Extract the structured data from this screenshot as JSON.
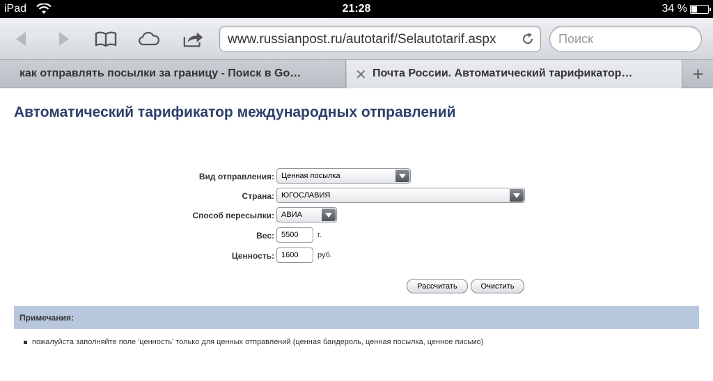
{
  "status_bar": {
    "device": "iPad",
    "time": "21:28",
    "battery": "34 %",
    "battery_level": 0.34
  },
  "toolbar": {
    "url": "www.russianpost.ru/autotarif/Selautotarif.aspx",
    "search_placeholder": "Поиск"
  },
  "tabs": [
    {
      "label": "как отправлять посылки за границу - Поиск в Go…",
      "active": false
    },
    {
      "label": "Почта России. Автоматический тарификатор…",
      "active": true
    }
  ],
  "page": {
    "title": "Автоматический тарификатор международных отправлений",
    "form": {
      "shipment_type": {
        "label": "Вид отправления:",
        "value": "Ценная посылка"
      },
      "country": {
        "label": "Страна:",
        "value": "ЮГОСЛАВИЯ"
      },
      "shipping_method": {
        "label": "Способ пересылки:",
        "value": "АВИА"
      },
      "weight": {
        "label": "Вес:",
        "value": "5500",
        "unit": "г."
      },
      "declared_value": {
        "label": "Ценность:",
        "value": "1600",
        "unit": "руб."
      }
    },
    "buttons": {
      "calculate": "Рассчитать",
      "clear": "Очистить"
    },
    "notes": {
      "title": "Примечания:",
      "items": [
        "пожалуйста заполняйте поле 'ценность' только для ценных отправлений (ценная бандероль, ценная посылка, ценное письмо)"
      ]
    }
  }
}
